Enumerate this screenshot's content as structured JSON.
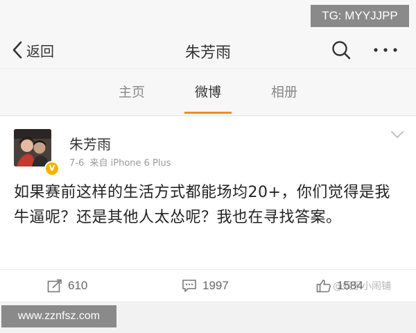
{
  "overlay": {
    "tg_label": "TG: MYYJJPP",
    "site_label": "www.zznfsz.com",
    "weibo_watermark": "@娱乐小闹铺"
  },
  "navbar": {
    "back_label": "返回",
    "title": "朱芳雨",
    "back_icon": "chevron-left-icon",
    "search_icon": "search-icon",
    "more_icon": "more-dots-icon"
  },
  "tabs": [
    {
      "label": "主页",
      "active": false
    },
    {
      "label": "微博",
      "active": true
    },
    {
      "label": "相册",
      "active": false
    }
  ],
  "post": {
    "author": "朱芳雨",
    "date": "7-6",
    "source": "来自 iPhone 6 Plus",
    "verified_badge": "V",
    "text": "如果赛前这样的生活方式都能场均20+，你们觉得是我牛逼呢？还是其他人太怂呢？我也在寻找答案。"
  },
  "actions": {
    "repost_count": "610",
    "comment_count": "1997",
    "like_count": "1584",
    "repost_icon": "repost-icon",
    "comment_icon": "comment-icon",
    "like_icon": "thumbs-up-icon"
  },
  "colors": {
    "accent": "#f08c1b",
    "verified": "#f4b400"
  }
}
